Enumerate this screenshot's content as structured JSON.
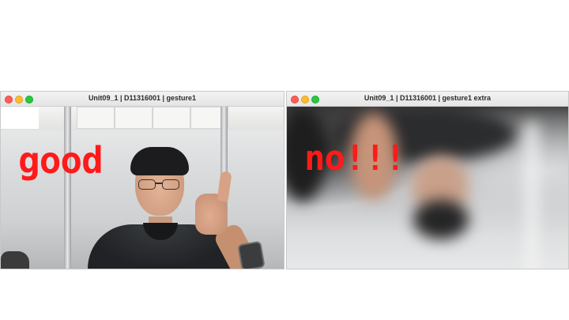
{
  "windows": [
    {
      "title": "Unit09_1 | D11316001 | gesture1",
      "overlay_text": "good",
      "overlay_color": "#ff1a1a"
    },
    {
      "title": "Unit09_1 | D11316001 | gesture1 extra",
      "overlay_text": "no!!!",
      "overlay_color": "#ff1a1a"
    }
  ],
  "colors": {
    "traffic_close": "#ff5f57",
    "traffic_minimize": "#febc2e",
    "traffic_maximize": "#28c840"
  }
}
